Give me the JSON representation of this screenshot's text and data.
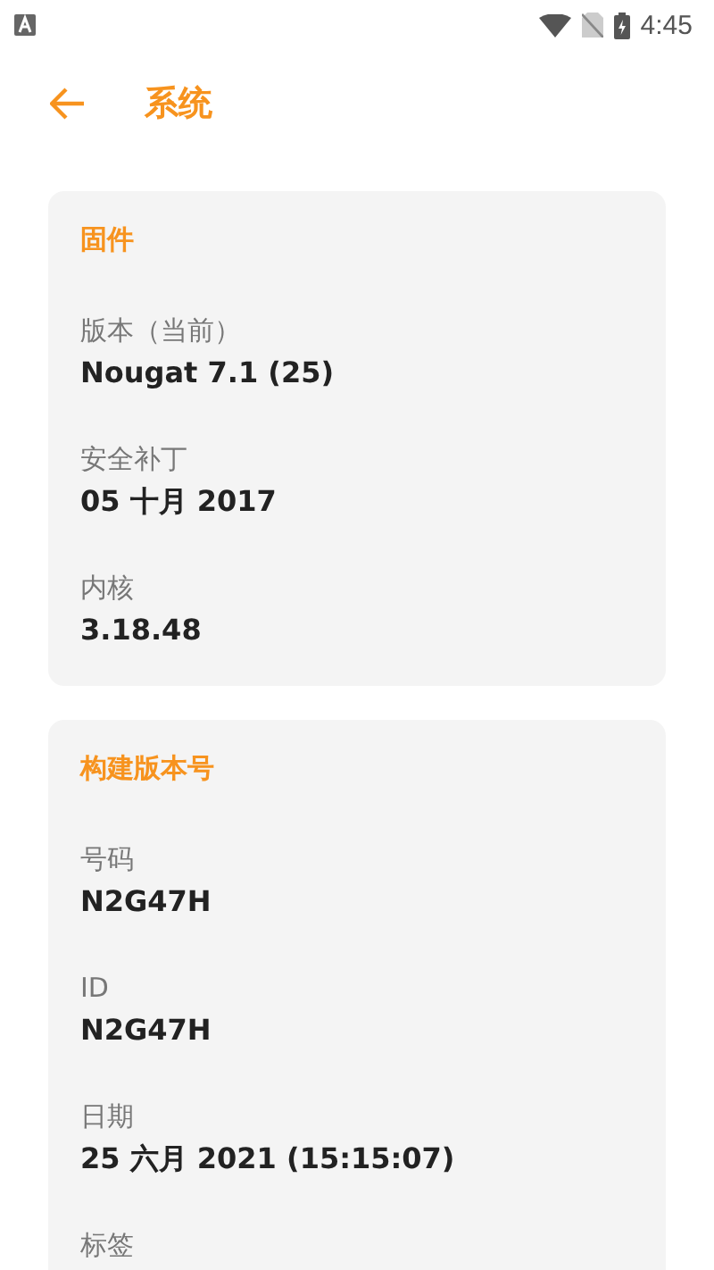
{
  "status_bar": {
    "time": "4:45"
  },
  "app_bar": {
    "title": "系统"
  },
  "sections": [
    {
      "title": "固件",
      "items": [
        {
          "label": "版本（当前）",
          "value": "Nougat 7.1 (25)"
        },
        {
          "label": "安全补丁",
          "value": "05 十月 2017"
        },
        {
          "label": "内核",
          "value": "3.18.48"
        }
      ]
    },
    {
      "title": "构建版本号",
      "items": [
        {
          "label": "号码",
          "value": "N2G47H"
        },
        {
          "label": "ID",
          "value": "N2G47H"
        },
        {
          "label": "日期",
          "value": "25 六月 2021 (15:15:07)"
        },
        {
          "label": "标签"
        }
      ]
    }
  ]
}
